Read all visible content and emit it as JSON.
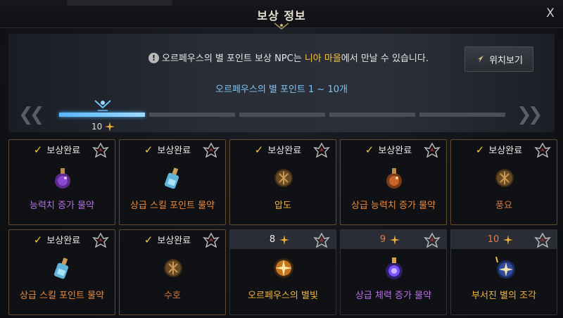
{
  "window": {
    "title": "보상 정보",
    "close_label": "X"
  },
  "notice": {
    "prefix": "오르페우스의 별 포인트 보상 NPC는 ",
    "highlight": "니아 마을",
    "suffix": "에서 만날 수 있습니다."
  },
  "locate_button": {
    "label": "위치보기"
  },
  "range_label": "오르페우스의 별 포인트 1 ~ 10개",
  "progress": {
    "current_count": "10",
    "active_fraction": 0.2
  },
  "nav": {
    "prev": "❮❮",
    "next": "❯❯"
  },
  "colors": {
    "accent_blue": "#7cc2f2",
    "highlight_gold": "#f3c53f",
    "check_gold": "#f2c744"
  },
  "cards": [
    {
      "status": "보상완료",
      "name": "능력치 증가 물약",
      "name_color": "purple",
      "icon": "purple-flask-icon"
    },
    {
      "status": "보상완료",
      "name": "상급 스킬 포인트 물약",
      "name_color": "orange",
      "icon": "blue-bottle-icon"
    },
    {
      "status": "보상완료",
      "name": "압도",
      "name_color": "gold",
      "icon": "rune-stone-icon"
    },
    {
      "status": "보상완료",
      "name": "상급 능력치 증가 물약",
      "name_color": "orange",
      "icon": "orange-flask-icon"
    },
    {
      "status": "보상완료",
      "name": "풍요",
      "name_color": "brown",
      "icon": "rune-stone-icon"
    },
    {
      "status": "보상완료",
      "name": "상급 스킬 포인트 물약",
      "name_color": "orange",
      "icon": "blue-bottle-icon"
    },
    {
      "status": "보상완료",
      "name": "수호",
      "name_color": "brown",
      "icon": "rune-stone-icon"
    },
    {
      "cost": "8",
      "name": "오르페우스의 별빛",
      "name_color": "gold",
      "icon": "star-orb-icon"
    },
    {
      "cost": "9",
      "name": "상급 체력 증가 물약",
      "name_color": "purple",
      "icon": "violet-flask-icon"
    },
    {
      "cost": "10",
      "name": "부서진 별의 조각",
      "name_color": "gold",
      "icon": "star-fragment-icon"
    }
  ]
}
